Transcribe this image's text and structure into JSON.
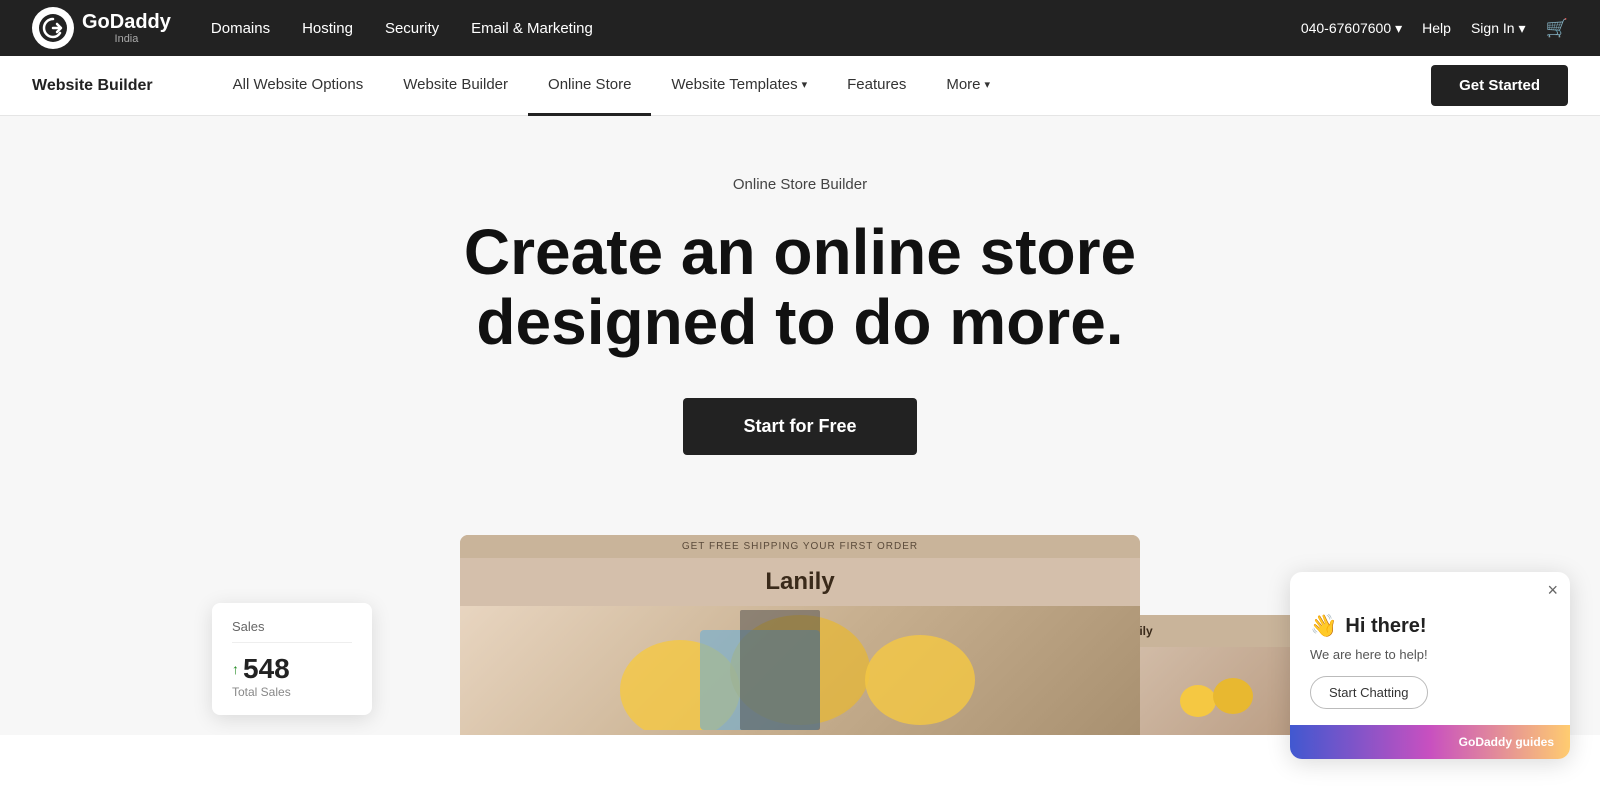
{
  "topbar": {
    "logo_name": "GoDaddy",
    "logo_country": "India",
    "nav_items": [
      {
        "label": "Domains"
      },
      {
        "label": "Hosting"
      },
      {
        "label": "Security"
      },
      {
        "label": "Email & Marketing"
      }
    ],
    "phone": "040-67607600",
    "help": "Help",
    "signin": "Sign In",
    "cart_icon": "🛒"
  },
  "secnav": {
    "brand": "Website Builder",
    "links": [
      {
        "label": "All Website Options",
        "active": false
      },
      {
        "label": "Website Builder",
        "active": false
      },
      {
        "label": "Online Store",
        "active": true
      },
      {
        "label": "Website Templates",
        "active": false,
        "has_chevron": true
      },
      {
        "label": "Features",
        "active": false
      },
      {
        "label": "More",
        "active": false,
        "has_chevron": true
      }
    ],
    "cta": "Get Started"
  },
  "hero": {
    "subtitle": "Online Store Builder",
    "title_line1": "Create an online store",
    "title_line2": "designed to do more.",
    "cta": "Start for Free"
  },
  "preview": {
    "banner": "GET FREE SHIPPING YOUR FIRST ORDER",
    "store_name": "Lanily",
    "sales_label": "Sales",
    "sales_number": "548",
    "sales_sub": "Total Sales"
  },
  "chat": {
    "wave": "👋",
    "greeting": "Hi there!",
    "sub": "We are here to help!",
    "start_btn": "Start Chatting",
    "footer": "GoDaddy guides",
    "close": "×"
  }
}
